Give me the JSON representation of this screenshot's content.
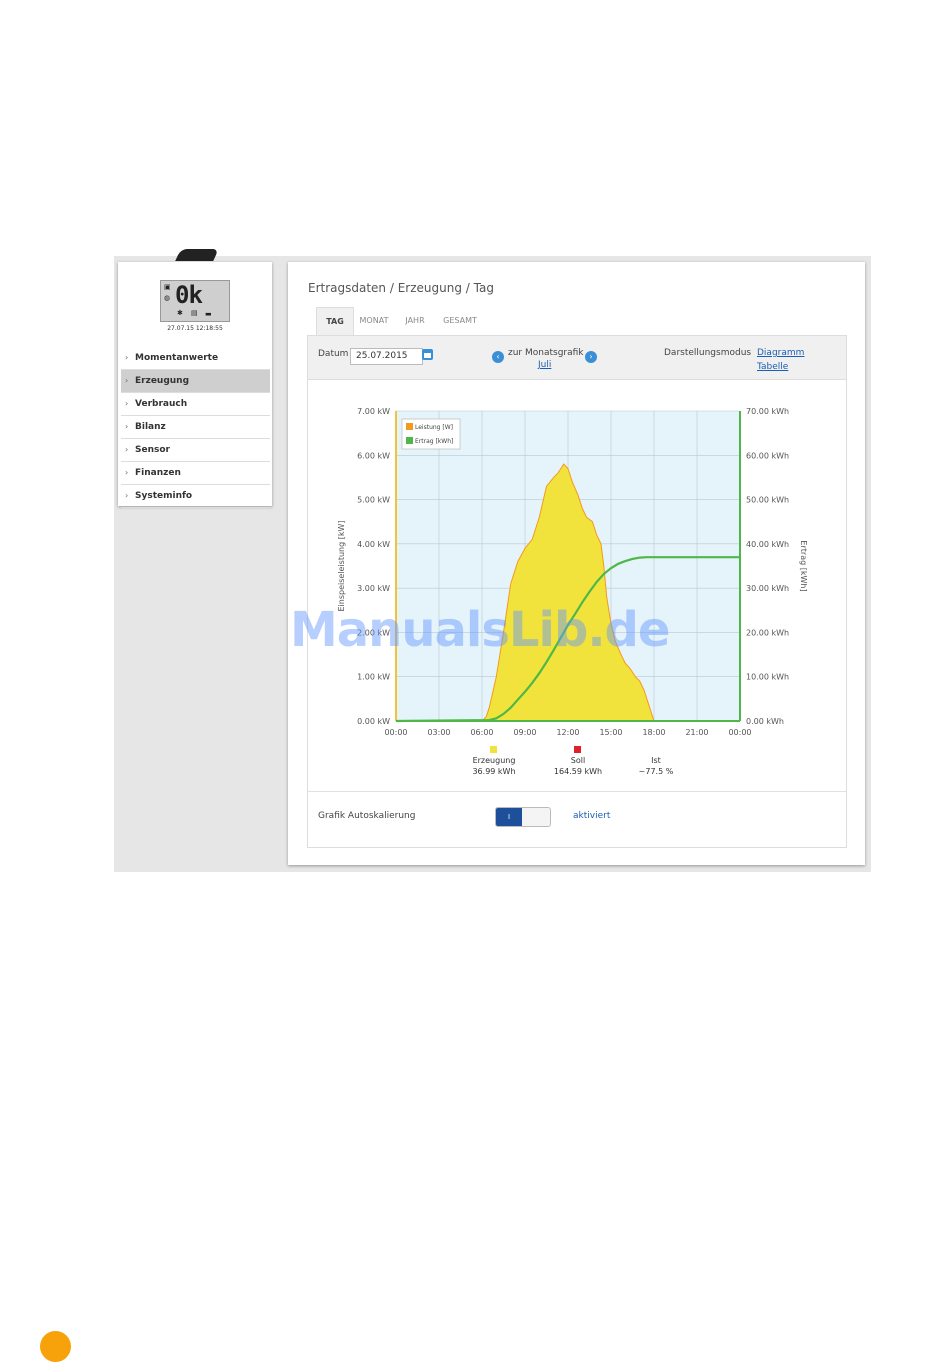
{
  "sidebar": {
    "display": {
      "status_text": "0k",
      "timestamp": "27.07.15 12:18:55"
    },
    "items": [
      {
        "label": "Momentanwerte",
        "active": false
      },
      {
        "label": "Erzeugung",
        "active": true
      },
      {
        "label": "Verbrauch",
        "active": false
      },
      {
        "label": "Bilanz",
        "active": false
      },
      {
        "label": "Sensor",
        "active": false
      },
      {
        "label": "Finanzen",
        "active": false
      },
      {
        "label": "Systeminfo",
        "active": false
      }
    ]
  },
  "main": {
    "breadcrumb": "Ertragsdaten / Erzeugung / Tag",
    "tabs": [
      {
        "label": "TAG",
        "active": true
      },
      {
        "label": "MONAT",
        "active": false
      },
      {
        "label": "JAHR",
        "active": false
      },
      {
        "label": "GESAMT",
        "active": false
      }
    ],
    "toolbar": {
      "date_label": "Datum",
      "date_value": "25.07.2015",
      "month_nav_label": "zur Monatsgrafik",
      "month_link": "Juli",
      "mode_label": "Darstellungsmodus",
      "mode_diagram": "Diagramm",
      "mode_table": "Tabelle"
    },
    "summary": [
      {
        "label": "Erzeugung",
        "value": "36.99 kWh",
        "color": "#f2e33c"
      },
      {
        "label": "Soll",
        "value": "164.59 kWh",
        "color": "#e0202a"
      },
      {
        "label": "Ist",
        "value": "~77.5 %"
      }
    ],
    "autoscale": {
      "label": "Grafik Autoskalierung",
      "toggle_text": "I",
      "status": "aktiviert"
    }
  },
  "chart_data": {
    "type": "area",
    "x_ticks": [
      "00:00",
      "03:00",
      "06:00",
      "09:00",
      "12:00",
      "15:00",
      "18:00",
      "21:00",
      "00:00"
    ],
    "y_left_ticks": [
      "0.00 kW",
      "1.00 kW",
      "2.00 kW",
      "3.00 kW",
      "4.00 kW",
      "5.00 kW",
      "6.00 kW",
      "7.00 kW"
    ],
    "y_right_ticks": [
      "0.00 kWh",
      "10.00 kWh",
      "20.00 kWh",
      "30.00 kWh",
      "40.00 kWh",
      "50.00 kWh",
      "60.00 kWh",
      "70.00 kWh"
    ],
    "ylabel_left": "Einspeiseleistung [kW]",
    "ylabel_right": "Ertrag [kWh]",
    "ylim_left": [
      0,
      7
    ],
    "ylim_right": [
      0,
      70
    ],
    "xlim_hours": [
      0,
      24
    ],
    "legend": [
      {
        "label": "Leistung [W]",
        "color": "#f29a1f"
      },
      {
        "label": "Ertrag [kWh]",
        "color": "#4db848"
      }
    ],
    "legend_position": "top-left",
    "grid": true,
    "plot_background": "#e5f3fa",
    "series": [
      {
        "name": "Leistung [W]",
        "unit": "kW",
        "fill": "#f2e33c",
        "stroke": "#f29a1f",
        "x": [
          0,
          6.0,
          6.3,
          6.5,
          7.0,
          7.5,
          8.0,
          8.5,
          9.0,
          9.5,
          10.0,
          10.5,
          11.0,
          11.3,
          11.5,
          11.7,
          12.0,
          12.3,
          12.7,
          13.0,
          13.3,
          13.7,
          14.0,
          14.3,
          14.5,
          14.7,
          15.0,
          15.3,
          15.7,
          16.0,
          16.3,
          16.7,
          17.0,
          17.3,
          17.7,
          18.0,
          24
        ],
        "y": [
          0,
          0,
          0.1,
          0.3,
          1.0,
          2.0,
          3.1,
          3.6,
          3.9,
          4.1,
          4.6,
          5.3,
          5.5,
          5.6,
          5.7,
          5.8,
          5.7,
          5.4,
          5.1,
          4.8,
          4.6,
          4.5,
          4.2,
          4.0,
          3.5,
          2.8,
          2.2,
          1.8,
          1.5,
          1.3,
          1.2,
          1.0,
          0.9,
          0.7,
          0.3,
          0,
          0
        ]
      },
      {
        "name": "Ertrag [kWh]",
        "unit": "kWh",
        "stroke": "#4db848",
        "x": [
          0,
          6.5,
          7.0,
          7.5,
          8.0,
          8.5,
          9.0,
          9.5,
          10.0,
          10.5,
          11.0,
          11.5,
          12.0,
          12.5,
          13.0,
          13.5,
          14.0,
          14.5,
          15.0,
          15.5,
          16.0,
          16.5,
          17.0,
          17.5,
          18.0,
          24
        ],
        "y": [
          0,
          0.2,
          0.6,
          1.6,
          3.0,
          4.8,
          6.6,
          8.6,
          10.8,
          13.3,
          16.0,
          18.8,
          21.7,
          24.2,
          26.8,
          29.2,
          31.4,
          33.2,
          34.5,
          35.5,
          36.1,
          36.6,
          36.9,
          36.99,
          36.99,
          36.99
        ]
      }
    ]
  },
  "watermark": "ManualsLib.de"
}
